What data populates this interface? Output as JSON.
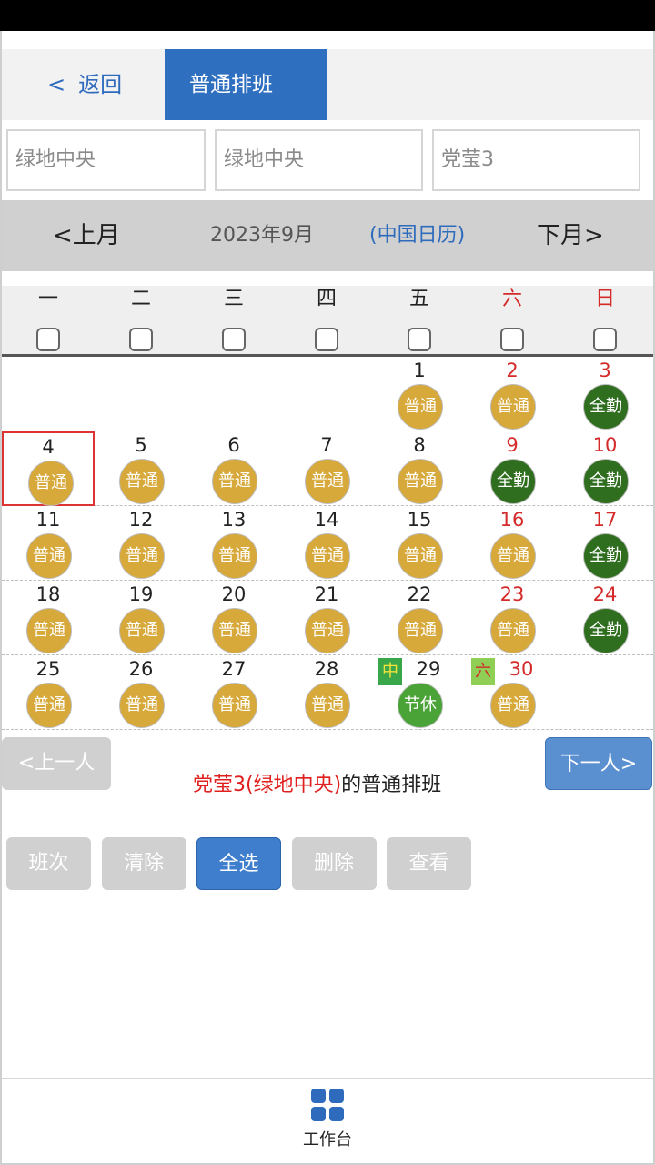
{
  "header": {
    "back_chevron": "<",
    "back_label": "返回",
    "title": "普通排班"
  },
  "filters": [
    "绿地中央",
    "绿地中央",
    "党莹3"
  ],
  "month_nav": {
    "prev": "<上月",
    "current": "2023年9月",
    "calendar_type": "(中国日历)",
    "next": "下月>"
  },
  "weekdays": [
    {
      "label": "一",
      "weekend": false
    },
    {
      "label": "二",
      "weekend": false
    },
    {
      "label": "三",
      "weekend": false
    },
    {
      "label": "四",
      "weekend": false
    },
    {
      "label": "五",
      "weekend": false
    },
    {
      "label": "六",
      "weekend": true
    },
    {
      "label": "日",
      "weekend": true
    }
  ],
  "shift_types": {
    "normal": {
      "label": "普通",
      "color": "#d7a83a"
    },
    "full": {
      "label": "全勤",
      "color": "#2f6e1f"
    },
    "holiday": {
      "label": "节休",
      "color": "#4aa337"
    }
  },
  "calendar": [
    [
      null,
      null,
      null,
      null,
      {
        "day": "1",
        "shift": "普通",
        "type": "normal",
        "red": false
      },
      {
        "day": "2",
        "shift": "普通",
        "type": "normal",
        "red": true
      },
      {
        "day": "3",
        "shift": "全勤",
        "type": "full",
        "red": true
      }
    ],
    [
      {
        "day": "4",
        "shift": "普通",
        "type": "normal",
        "red": false,
        "selected": true
      },
      {
        "day": "5",
        "shift": "普通",
        "type": "normal",
        "red": false
      },
      {
        "day": "6",
        "shift": "普通",
        "type": "normal",
        "red": false
      },
      {
        "day": "7",
        "shift": "普通",
        "type": "normal",
        "red": false
      },
      {
        "day": "8",
        "shift": "普通",
        "type": "normal",
        "red": false
      },
      {
        "day": "9",
        "shift": "全勤",
        "type": "full",
        "red": true
      },
      {
        "day": "10",
        "shift": "全勤",
        "type": "full",
        "red": true
      }
    ],
    [
      {
        "day": "11",
        "shift": "普通",
        "type": "normal",
        "red": false
      },
      {
        "day": "12",
        "shift": "普通",
        "type": "normal",
        "red": false
      },
      {
        "day": "13",
        "shift": "普通",
        "type": "normal",
        "red": false
      },
      {
        "day": "14",
        "shift": "普通",
        "type": "normal",
        "red": false
      },
      {
        "day": "15",
        "shift": "普通",
        "type": "normal",
        "red": false
      },
      {
        "day": "16",
        "shift": "普通",
        "type": "normal",
        "red": true
      },
      {
        "day": "17",
        "shift": "全勤",
        "type": "full",
        "red": true
      }
    ],
    [
      {
        "day": "18",
        "shift": "普通",
        "type": "normal",
        "red": false
      },
      {
        "day": "19",
        "shift": "普通",
        "type": "normal",
        "red": false
      },
      {
        "day": "20",
        "shift": "普通",
        "type": "normal",
        "red": false
      },
      {
        "day": "21",
        "shift": "普通",
        "type": "normal",
        "red": false
      },
      {
        "day": "22",
        "shift": "普通",
        "type": "normal",
        "red": false
      },
      {
        "day": "23",
        "shift": "普通",
        "type": "normal",
        "red": true
      },
      {
        "day": "24",
        "shift": "全勤",
        "type": "full",
        "red": true
      }
    ],
    [
      {
        "day": "25",
        "shift": "普通",
        "type": "normal",
        "red": false
      },
      {
        "day": "26",
        "shift": "普通",
        "type": "normal",
        "red": false
      },
      {
        "day": "27",
        "shift": "普通",
        "type": "normal",
        "red": false
      },
      {
        "day": "28",
        "shift": "普通",
        "type": "normal",
        "red": false
      },
      {
        "day": "29",
        "shift": "节休",
        "type": "holiday",
        "red": false,
        "tag": "中",
        "tag_type": "mid"
      },
      {
        "day": "30",
        "shift": "普通",
        "type": "normal",
        "red": true,
        "tag": "六",
        "tag_type": "sat"
      },
      null
    ]
  ],
  "person_nav": {
    "prev": "<上一人",
    "next": "下一人>"
  },
  "caption": {
    "name": "党莹3",
    "org": "(绿地中央)",
    "suffix": "的普通排班"
  },
  "actions": [
    {
      "label": "班次",
      "primary": false
    },
    {
      "label": "清除",
      "primary": false
    },
    {
      "label": "全选",
      "primary": true
    },
    {
      "label": "删除",
      "primary": false
    },
    {
      "label": "查看",
      "primary": false
    }
  ],
  "tabbar": {
    "workbench": "工作台"
  },
  "colors": {
    "accent": "#2f6fc0",
    "weekend_red": "#d42a2a",
    "caption_red": "#e0201f"
  }
}
